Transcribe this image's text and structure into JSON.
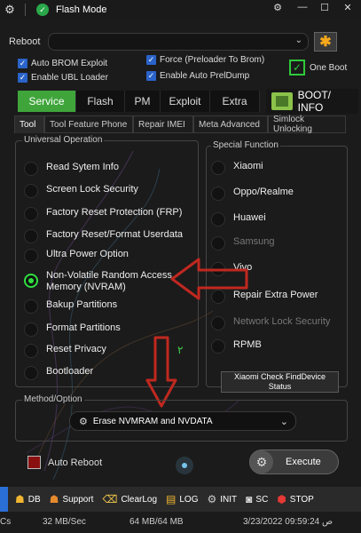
{
  "titlebar": {
    "title": "Flash Mode",
    "gear_icon": "gear-icon",
    "minimize": "—",
    "maximize": "☐",
    "close": "✕",
    "pin": "⚙"
  },
  "reboot": {
    "label": "Reboot",
    "value": "",
    "star_icon": "✱"
  },
  "options": {
    "auto_brom": "Auto BROM Exploit",
    "enable_ubl": "Enable UBL Loader",
    "force_preloader": "Force (Preloader To Brom)",
    "enable_preldump": "Enable Auto PrelDump",
    "one_boot": "One Boot"
  },
  "main_tabs": [
    "Service",
    "Flash",
    "PM",
    "Exploit",
    "Extra"
  ],
  "boot_info": "BOOT/ INFO",
  "sub_tabs": [
    "Tool",
    "Tool Feature Phone",
    "Repair IMEI",
    "Meta Advanced",
    "Simlock Unlocking"
  ],
  "universal": {
    "title": "Universal Operation",
    "items": [
      "Read Sytem Info",
      "Screen Lock Security",
      "Factory Reset Protection (FRP)",
      "Factory Reset/Format Userdata",
      "Ultra Power Option",
      "Non-Volatile Random Access Memory (NVRAM)",
      "Bakup Partitions",
      "Format Partitions",
      "Reset Privacy",
      "Bootloader"
    ],
    "selected_index": 5,
    "arabic_mark": "٢"
  },
  "special": {
    "title": "Special Function",
    "items": [
      "Xiaomi",
      "Oppo/Realme",
      "Huawei",
      "Samsung",
      "Vivo",
      "Repair Extra Power",
      "Network Lock Security",
      "RPMB"
    ],
    "disabled": [
      "Samsung",
      "Network Lock Security"
    ],
    "xiaomi_button": "Xiaomi Check FindDevice Status"
  },
  "method": {
    "title": "Method/Option",
    "value": "Erase NVMRAM and NVDATA"
  },
  "auto_reboot": "Auto Reboot",
  "execute": "Execute",
  "toolbar": [
    "DB",
    "Support",
    "ClearLog",
    "LOG",
    "INIT",
    "SC",
    "STOP"
  ],
  "status": {
    "left": "Cs",
    "speed": "32 MB/Sec",
    "size": "64 MB/64 MB",
    "datetime": "3/23/2022 09:59:24 ص"
  },
  "colors": {
    "accent_green": "#3fa53b",
    "radio_selected": "#2fe040",
    "arrow_red": "#c0281f",
    "check_blue": "#2a63c9"
  }
}
